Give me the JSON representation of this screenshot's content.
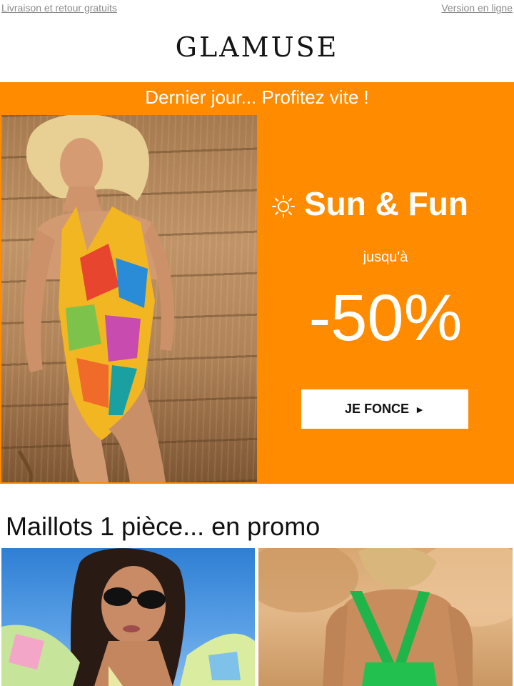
{
  "topbar": {
    "left_link": "Livraison et retour gratuits",
    "right_link": "Version en ligne"
  },
  "brand": {
    "logo": "GLAMUSE"
  },
  "hero": {
    "headline": "Dernier jour... Profitez vite !",
    "title": "Sun & Fun",
    "title_icon": "sun-icon",
    "upto": "jusqu'à",
    "discount": "-50%",
    "cta_label": "JE FONCE",
    "cta_icon": "play-arrow-icon",
    "accent_color": "#ff8c00"
  },
  "section": {
    "title": "Maillots 1 pièce... en promo"
  }
}
